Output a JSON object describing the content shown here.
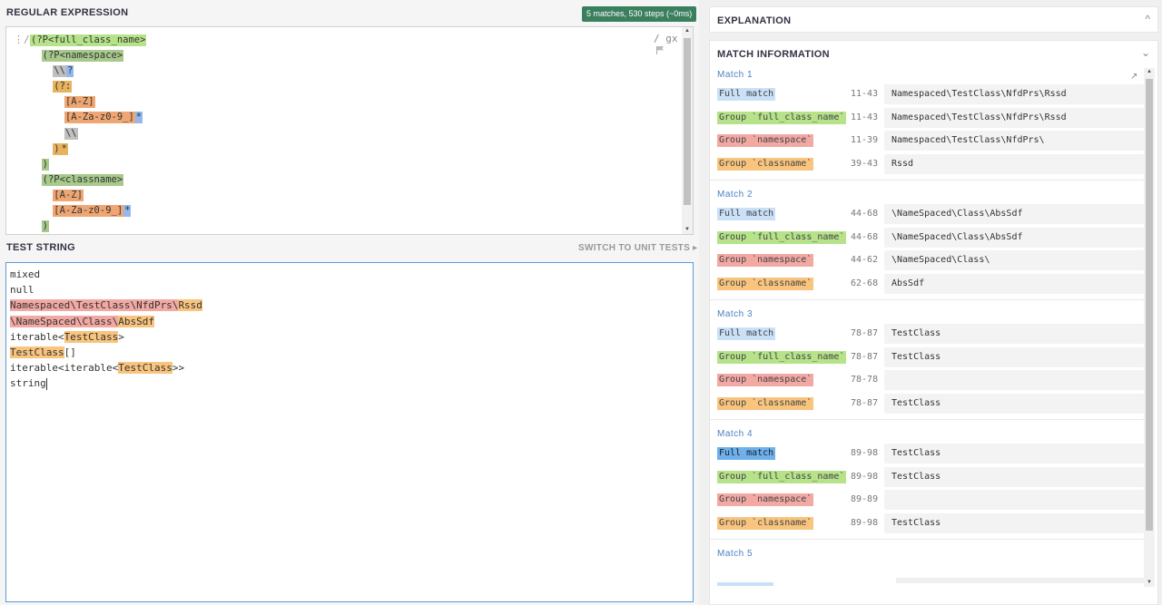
{
  "regex": {
    "title": "REGULAR EXPRESSION",
    "badge": "5 matches, 530 steps (~0ms)",
    "prefix": "⋮/",
    "flags": "/ gx",
    "lines": [
      {
        "indent": 0,
        "tokens": [
          {
            "t": "(?P<full_class_name>",
            "c": "t-g1"
          }
        ]
      },
      {
        "indent": 2,
        "tokens": [
          {
            "t": "(?P<namespace>",
            "c": "t-g2"
          }
        ]
      },
      {
        "indent": 4,
        "tokens": [
          {
            "t": "\\\\",
            "c": "t-esc"
          },
          {
            "t": "?",
            "c": "t-q"
          }
        ]
      },
      {
        "indent": 4,
        "tokens": [
          {
            "t": "(?:",
            "c": "t-grp"
          }
        ]
      },
      {
        "indent": 6,
        "tokens": [
          {
            "t": "[A-Z]",
            "c": "t-cls"
          }
        ]
      },
      {
        "indent": 6,
        "tokens": [
          {
            "t": "[A-Za-z0-9_]",
            "c": "t-cls"
          },
          {
            "t": "*",
            "c": "t-q"
          }
        ]
      },
      {
        "indent": 6,
        "tokens": [
          {
            "t": "\\\\",
            "c": "t-esc"
          }
        ]
      },
      {
        "indent": 4,
        "tokens": [
          {
            "t": ")",
            "c": "t-grp"
          },
          {
            "t": "*",
            "c": "t-grp"
          }
        ]
      },
      {
        "indent": 2,
        "tokens": [
          {
            "t": ")",
            "c": "t-g2"
          }
        ]
      },
      {
        "indent": 2,
        "tokens": [
          {
            "t": "(?P<classname>",
            "c": "t-g2"
          }
        ]
      },
      {
        "indent": 4,
        "tokens": [
          {
            "t": "[A-Z]",
            "c": "t-cls"
          }
        ]
      },
      {
        "indent": 4,
        "tokens": [
          {
            "t": "[A-Za-z0-9_]",
            "c": "t-cls"
          },
          {
            "t": "*",
            "c": "t-q"
          }
        ]
      },
      {
        "indent": 2,
        "tokens": [
          {
            "t": ")",
            "c": "t-g2"
          }
        ]
      }
    ]
  },
  "test": {
    "title": "TEST STRING",
    "switch": "SWITCH TO UNIT TESTS ▸",
    "lines": [
      [
        {
          "t": "mixed"
        }
      ],
      [
        {
          "t": "null"
        }
      ],
      [
        {
          "t": "Namespaced\\TestClass\\NfdPrs\\",
          "c": "hl-ns"
        },
        {
          "t": "Rssd",
          "c": "hl-cn"
        }
      ],
      [
        {
          "t": "\\NameSpaced\\Class\\",
          "c": "hl-ns"
        },
        {
          "t": "AbsSdf",
          "c": "hl-cn"
        }
      ],
      [
        {
          "t": "iterable<"
        },
        {
          "t": "TestClass",
          "c": "hl-cn"
        },
        {
          "t": ">"
        }
      ],
      [
        {
          "t": "TestClass",
          "c": "hl-cn"
        },
        {
          "t": "[]"
        }
      ],
      [
        {
          "t": "iterable<iterable<"
        },
        {
          "t": "TestClass",
          "c": "hl-cn"
        },
        {
          "t": ">>"
        }
      ],
      [
        {
          "t": "string"
        },
        {
          "caret": true
        }
      ]
    ]
  },
  "explanation": {
    "title": "EXPLANATION",
    "chevron": "^"
  },
  "match_info": {
    "title": "MATCH INFORMATION",
    "chevron": "⌄",
    "share_icon": "↗",
    "matches": [
      {
        "label": "Match 1",
        "rows": [
          {
            "tag": "Full match",
            "range": "11-43",
            "value": "Namespaced\\TestClass\\NfdPrs\\Rssd"
          },
          {
            "tag": "Group `full_class_name`",
            "range": "11-43",
            "value": "Namespaced\\TestClass\\NfdPrs\\Rssd"
          },
          {
            "tag": "Group `namespace`",
            "range": "11-39",
            "value": "Namespaced\\TestClass\\NfdPrs\\"
          },
          {
            "tag": "Group `classname`",
            "range": "39-43",
            "value": "Rssd"
          }
        ]
      },
      {
        "label": "Match 2",
        "rows": [
          {
            "tag": "Full match",
            "range": "44-68",
            "value": "\\NameSpaced\\Class\\AbsSdf"
          },
          {
            "tag": "Group `full_class_name`",
            "range": "44-68",
            "value": "\\NameSpaced\\Class\\AbsSdf"
          },
          {
            "tag": "Group `namespace`",
            "range": "44-62",
            "value": "\\NameSpaced\\Class\\"
          },
          {
            "tag": "Group `classname`",
            "range": "62-68",
            "value": "AbsSdf"
          }
        ]
      },
      {
        "label": "Match 3",
        "rows": [
          {
            "tag": "Full match",
            "range": "78-87",
            "value": "TestClass"
          },
          {
            "tag": "Group `full_class_name`",
            "range": "78-87",
            "value": "TestClass"
          },
          {
            "tag": "Group `namespace`",
            "range": "78-78",
            "value": ""
          },
          {
            "tag": "Group `classname`",
            "range": "78-87",
            "value": "TestClass"
          }
        ]
      },
      {
        "label": "Match 4",
        "rows": [
          {
            "tag": "Full match",
            "range": "89-98",
            "value": "TestClass"
          },
          {
            "tag": "Group `full_class_name`",
            "range": "89-98",
            "value": "TestClass"
          },
          {
            "tag": "Group `namespace`",
            "range": "89-89",
            "value": ""
          },
          {
            "tag": "Group `classname`",
            "range": "89-98",
            "value": "TestClass"
          }
        ]
      },
      {
        "label": "Match 5",
        "rows": []
      }
    ]
  }
}
